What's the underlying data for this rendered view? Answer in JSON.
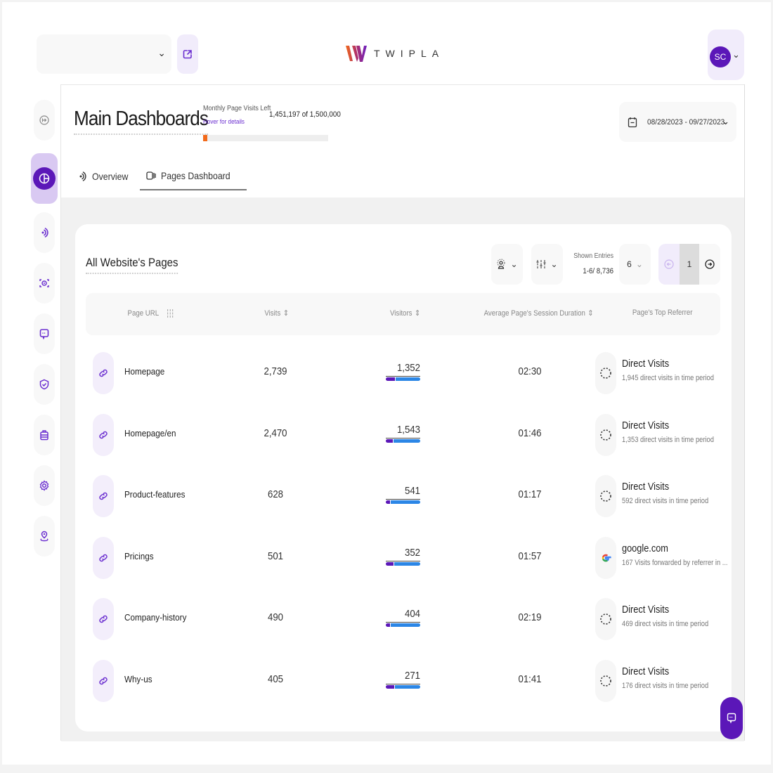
{
  "topbar": {
    "site_select_value": "",
    "logo_text": "TWIPLA",
    "user_initials": "SC"
  },
  "colors": {
    "brand_purple": "#5b17b8",
    "accent_orange": "#f26a1b",
    "visitors_returning": "#2b86e6",
    "visitors_new": "#5b17b8"
  },
  "sidebar": {
    "items": [
      {
        "name": "collapse",
        "icon": "arrow-right-circle-icon",
        "active": false
      },
      {
        "name": "dashboards",
        "icon": "pie-chart-icon",
        "active": true
      },
      {
        "name": "analytics",
        "icon": "signal-icon",
        "active": false
      },
      {
        "name": "behavior",
        "icon": "eye-scan-icon",
        "active": false
      },
      {
        "name": "surveys",
        "icon": "chat-icon",
        "active": false
      },
      {
        "name": "privacy",
        "icon": "shield-check-icon",
        "active": false
      },
      {
        "name": "apps",
        "icon": "briefcase-icon",
        "active": false
      },
      {
        "name": "settings",
        "icon": "gear-icon",
        "active": false
      },
      {
        "name": "tracking",
        "icon": "location-pin-icon",
        "active": false
      }
    ]
  },
  "header": {
    "title": "Main Dashboards",
    "quota": {
      "label": "Monthly Page Visits Left",
      "link": "Hover for details",
      "value": "1,451,197 of 1,500,000",
      "used_fraction": 0.033
    },
    "date_range": "08/28/2023 - 09/27/2023",
    "tabs": [
      {
        "label": "Overview",
        "active": false
      },
      {
        "label": "Pages Dashboard",
        "active": true
      }
    ]
  },
  "card": {
    "title": "All Website's Pages",
    "entries_label": "Shown Entries",
    "entries_range": "1-6/ 8,736",
    "page_size": "6",
    "current_page": "1",
    "columns": [
      "Page URL",
      "Visits",
      "Visitors",
      "Average Page's Session Duration",
      "Page's Top Referrer"
    ],
    "rows": [
      {
        "page": "Homepage",
        "visits": "2,739",
        "visitors": "1,352",
        "new_fraction": 0.27,
        "duration": "02:30",
        "referrer": "Direct Visits",
        "referrer_type": "direct",
        "referrer_sub": "1,945 direct visits in time period"
      },
      {
        "page": "Homepage/en",
        "visits": "2,470",
        "visitors": "1,543",
        "new_fraction": 0.2,
        "duration": "01:46",
        "referrer": "Direct Visits",
        "referrer_type": "direct",
        "referrer_sub": "1,353 direct visits in time period"
      },
      {
        "page": "Product-features",
        "visits": "628",
        "visitors": "541",
        "new_fraction": 0.13,
        "duration": "01:17",
        "referrer": "Direct Visits",
        "referrer_type": "direct",
        "referrer_sub": "592 direct visits in time period"
      },
      {
        "page": "Pricings",
        "visits": "501",
        "visitors": "352",
        "new_fraction": 0.23,
        "duration": "01:57",
        "referrer": "google.com",
        "referrer_type": "google",
        "referrer_sub": "167 Visits forwarded by referrer in ..."
      },
      {
        "page": "Company-history",
        "visits": "490",
        "visitors": "404",
        "new_fraction": 0.13,
        "duration": "02:19",
        "referrer": "Direct Visits",
        "referrer_type": "direct",
        "referrer_sub": "469 direct visits in time period"
      },
      {
        "page": "Why-us",
        "visits": "405",
        "visitors": "271",
        "new_fraction": 0.24,
        "duration": "01:41",
        "referrer": "Direct Visits",
        "referrer_type": "direct",
        "referrer_sub": "176 direct visits in time period"
      }
    ]
  }
}
